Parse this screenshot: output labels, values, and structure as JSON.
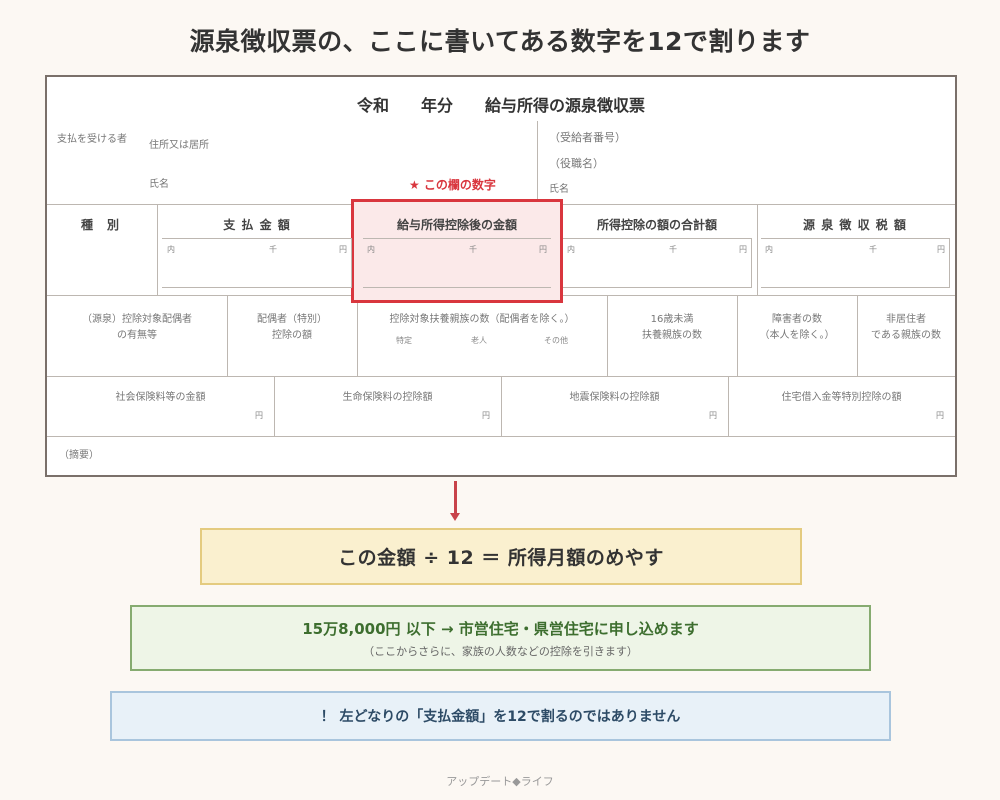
{
  "title": "源泉徴収票の、ここに書いてある数字を12で割ります",
  "form": {
    "title": "令和　　年分　　給与所得の源泉徴収票",
    "recipient_label": "支払を受ける者",
    "address_label": "住所又は居所",
    "name_label": "氏名",
    "recipient_no": "（受給者番号）",
    "position": "（役職名）",
    "name_label_right": "氏名",
    "star_note": "★ この欄の数字",
    "headers": {
      "type": "種　別",
      "payment": "支 払 金 額",
      "after_deduction": "給与所得控除後の金額",
      "deduction_total": "所得控除の額の合計額",
      "withholding": "源 泉 徴 収 税 額"
    },
    "units": {
      "sen": "内",
      "thousand": "千",
      "yen": "円"
    },
    "row3": {
      "c1_line1": "（源泉）控除対象配偶者",
      "c1_line2": "の有無等",
      "c2_line1": "配偶者（特別）",
      "c2_line2": "控除の額",
      "c3_line1": "控除対象扶養親族の数（配偶者を除く。）",
      "c3_sub1": "特定",
      "c3_sub2": "老人",
      "c3_sub3": "その他",
      "c4_line1": "16歳未満",
      "c4_line2": "扶養親族の数",
      "c5_line1": "障害者の数",
      "c5_line2": "（本人を除く。）",
      "c6_line1": "非居住者",
      "c6_line2": "である親族の数"
    },
    "row4": {
      "c1": "社会保険料等の金額",
      "c2": "生命保険料の控除額",
      "c3": "地震保険料の控除額",
      "c4": "住宅借入金等特別控除の額",
      "yen": "円"
    },
    "summary": "（摘要）"
  },
  "formula": "この金額 ÷ 12 ＝ 所得月額のめやす",
  "criteria": {
    "main": "15万8,000円 以下 → 市営住宅・県営住宅に申し込めます",
    "sub": "（ここからさらに、家族の人数などの控除を引きます）"
  },
  "warning": "！ 左どなりの「支払金額」を12で割るのではありません",
  "footer": "アップデート◆ライフ",
  "colors": {
    "highlight_border": "#d9363e",
    "highlight_fill": "#fbe9e9",
    "yellow_fill": "#faf0cf",
    "green_fill": "#eef5e7",
    "green_text": "#3d6e2f",
    "blue_fill": "#e8f1f8"
  }
}
